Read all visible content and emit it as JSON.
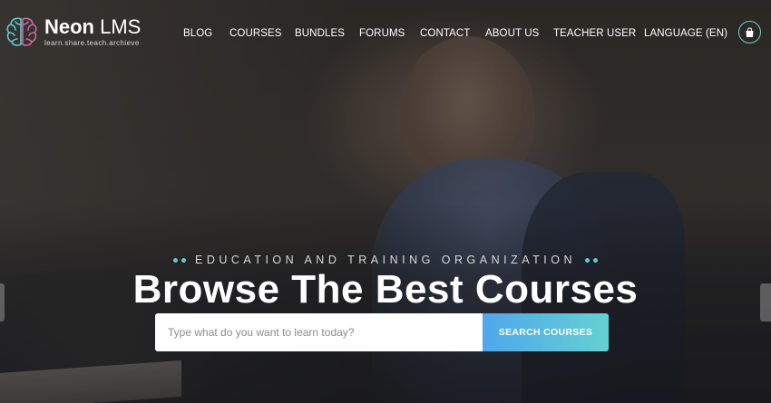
{
  "brand": {
    "name_bold": "Neon",
    "name_light": " LMS",
    "tagline": "learn.share.teach.archieve",
    "accent_color": "#61c7d3"
  },
  "nav": {
    "items": [
      {
        "label": "BLOG"
      },
      {
        "label": "COURSES"
      },
      {
        "label": "BUNDLES"
      },
      {
        "label": "FORUMS"
      },
      {
        "label": "CONTACT"
      },
      {
        "label": "ABOUT US"
      },
      {
        "label": "TEACHER USER"
      },
      {
        "label": "LANGUAGE (EN)"
      }
    ],
    "cart_icon": "shopping-bag-icon"
  },
  "hero": {
    "subtitle": "EDUCATION AND TRAINING ORGANIZATION",
    "headline": "Browse The Best Courses",
    "search": {
      "value": "",
      "placeholder": "Type what do you want to learn today?",
      "button_label": "SEARCH COURSES",
      "button_gradient": [
        "#4fa7ec",
        "#64d0d2"
      ]
    }
  }
}
